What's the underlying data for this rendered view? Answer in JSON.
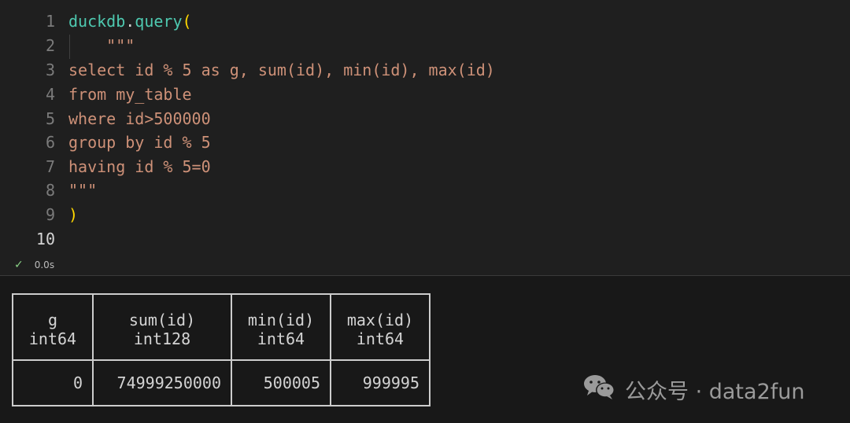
{
  "editor": {
    "lines": [
      {
        "n": "1",
        "parts": [
          {
            "t": "duckdb",
            "c": "ident"
          },
          {
            "t": ".",
            "c": "punc"
          },
          {
            "t": "query",
            "c": "ident"
          },
          {
            "t": "(",
            "c": "paren"
          }
        ]
      },
      {
        "n": "2",
        "parts": [
          {
            "t": "    \"\"\"",
            "c": "str"
          }
        ]
      },
      {
        "n": "3",
        "parts": [
          {
            "t": "select id % 5 as g, sum(id), min(id), max(id)",
            "c": "str"
          }
        ]
      },
      {
        "n": "4",
        "parts": [
          {
            "t": "from my_table",
            "c": "str"
          }
        ]
      },
      {
        "n": "5",
        "parts": [
          {
            "t": "where id>500000",
            "c": "str"
          }
        ]
      },
      {
        "n": "6",
        "parts": [
          {
            "t": "group by id % 5",
            "c": "str"
          }
        ]
      },
      {
        "n": "7",
        "parts": [
          {
            "t": "having id % 5=0",
            "c": "str"
          }
        ]
      },
      {
        "n": "8",
        "parts": [
          {
            "t": "\"\"\"",
            "c": "str"
          }
        ]
      },
      {
        "n": "9",
        "parts": [
          {
            "t": ")",
            "c": "paren"
          }
        ]
      },
      {
        "n": "10",
        "parts": []
      }
    ],
    "active_line": "10"
  },
  "status": {
    "check_icon": "check-icon",
    "time": "0.0s"
  },
  "result": {
    "columns": [
      {
        "name": "g",
        "type": "int64"
      },
      {
        "name": "sum(id)",
        "type": "int128"
      },
      {
        "name": "min(id)",
        "type": "int64"
      },
      {
        "name": "max(id)",
        "type": "int64"
      }
    ],
    "rows": [
      [
        "0",
        "74999250000",
        "500005",
        "999995"
      ]
    ]
  },
  "watermark": {
    "icon": "wechat-icon",
    "text": "公众号 · data2fun"
  },
  "colors": {
    "string": "#ce9178",
    "identifier": "#4ec9b0",
    "bracket": "#ffd700",
    "line_number": "#7b7b7b",
    "success": "#89d185"
  }
}
